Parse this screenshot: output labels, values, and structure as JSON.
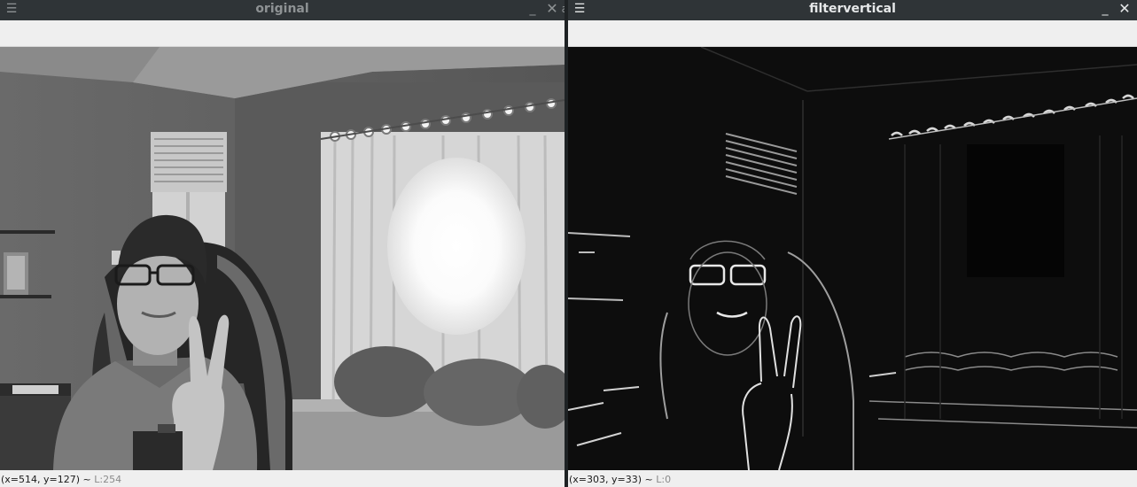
{
  "windows": {
    "left": {
      "title": "original",
      "menu_icon": "☰",
      "minimize_icon": "_",
      "close_icon": "✕",
      "title_overflow": "a",
      "status": {
        "coords": "(x=514, y=127)",
        "separator": " ~ ",
        "level": "L:254"
      }
    },
    "right": {
      "title": "filtervertical",
      "menu_icon": "☰",
      "minimize_icon": "_",
      "close_icon": "✕",
      "status": {
        "coords": "(x=303, y=33)",
        "separator": " ~ ",
        "level": "L:0"
      }
    }
  },
  "colors": {
    "titlebar_bg": "#2f3437",
    "toolbar_bg": "#efefef",
    "image_dark_bg": "#0b0b0b"
  }
}
